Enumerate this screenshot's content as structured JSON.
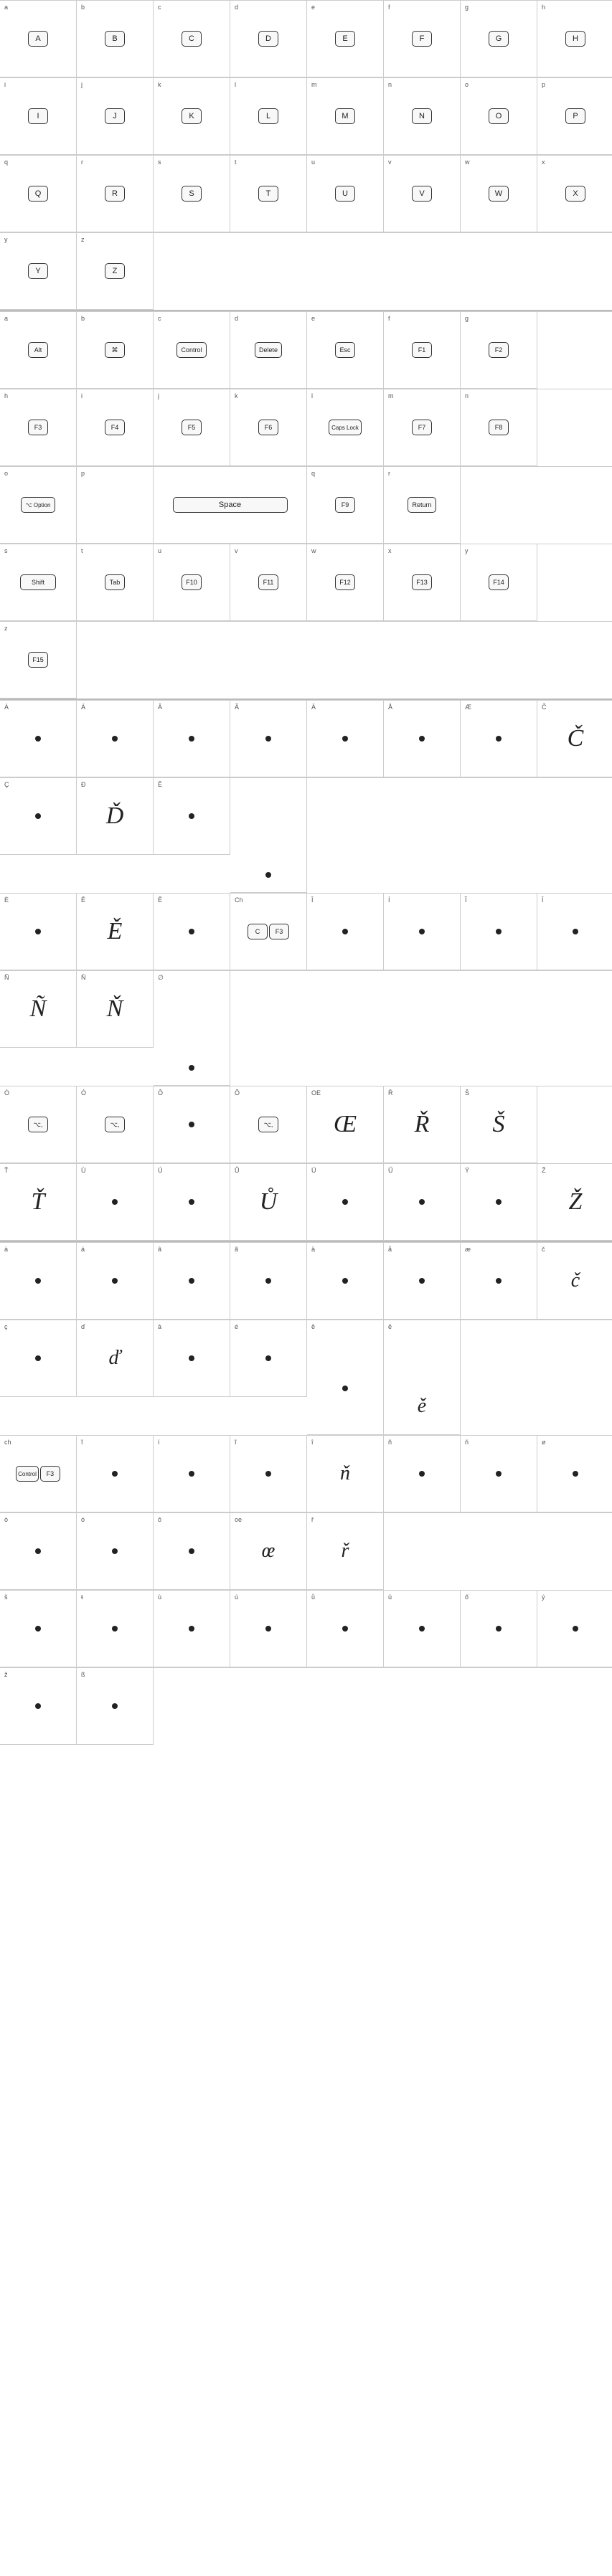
{
  "sections": {
    "uppercase": {
      "letters": [
        "A",
        "B",
        "C",
        "D",
        "E",
        "F",
        "G",
        "H",
        "I",
        "J",
        "K",
        "L",
        "M",
        "N",
        "O",
        "P",
        "Q",
        "R",
        "S",
        "T",
        "U",
        "V",
        "W",
        "X",
        "Y",
        "Z"
      ],
      "labels": [
        "a",
        "b",
        "c",
        "d",
        "e",
        "f",
        "g",
        "h",
        "i",
        "j",
        "k",
        "l",
        "m",
        "n",
        "o",
        "p",
        "q",
        "r",
        "s",
        "t",
        "u",
        "v",
        "w",
        "x",
        "y",
        "z"
      ]
    },
    "keys": {
      "row1": [
        {
          "label": "a",
          "key": "Alt",
          "type": "small"
        },
        {
          "label": "b",
          "key": "⌘",
          "type": "small"
        },
        {
          "label": "c",
          "key": "Control",
          "type": "small"
        },
        {
          "label": "d",
          "key": "Delete",
          "type": "small"
        },
        {
          "label": "e",
          "key": "Esc",
          "type": "small"
        },
        {
          "label": "f",
          "key": "F1",
          "type": "small"
        },
        {
          "label": "g",
          "key": "F2",
          "type": "small"
        }
      ],
      "row2": [
        {
          "label": "h",
          "key": "F3",
          "type": "small"
        },
        {
          "label": "i",
          "key": "F4",
          "type": "small"
        },
        {
          "label": "j",
          "key": "F5",
          "type": "small"
        },
        {
          "label": "k",
          "key": "F6",
          "type": "small"
        },
        {
          "label": "l",
          "key": "Caps Lock",
          "type": "medium"
        },
        {
          "label": "m",
          "key": "F7",
          "type": "small"
        },
        {
          "label": "n",
          "key": "F8",
          "type": "small"
        }
      ],
      "row3": [
        {
          "label": "o",
          "key": "⌥ Option",
          "type": "small"
        },
        {
          "label": "p",
          "key": "Space",
          "type": "wide"
        },
        {
          "label": "q",
          "key": "F9",
          "type": "small"
        },
        {
          "label": "r",
          "key": "Return",
          "type": "small"
        }
      ],
      "row4": [
        {
          "label": "s",
          "key": "Shift",
          "type": "medium"
        },
        {
          "label": "t",
          "key": "Tab",
          "type": "small"
        },
        {
          "label": "u",
          "key": "F10",
          "type": "small"
        },
        {
          "label": "v",
          "key": "F11",
          "type": "small"
        },
        {
          "label": "w",
          "key": "F12",
          "type": "small"
        },
        {
          "label": "x",
          "key": "F13",
          "type": "small"
        },
        {
          "label": "y",
          "key": "F14",
          "type": "small"
        }
      ],
      "row5": [
        {
          "label": "z",
          "key": "F15",
          "type": "small"
        }
      ]
    }
  }
}
